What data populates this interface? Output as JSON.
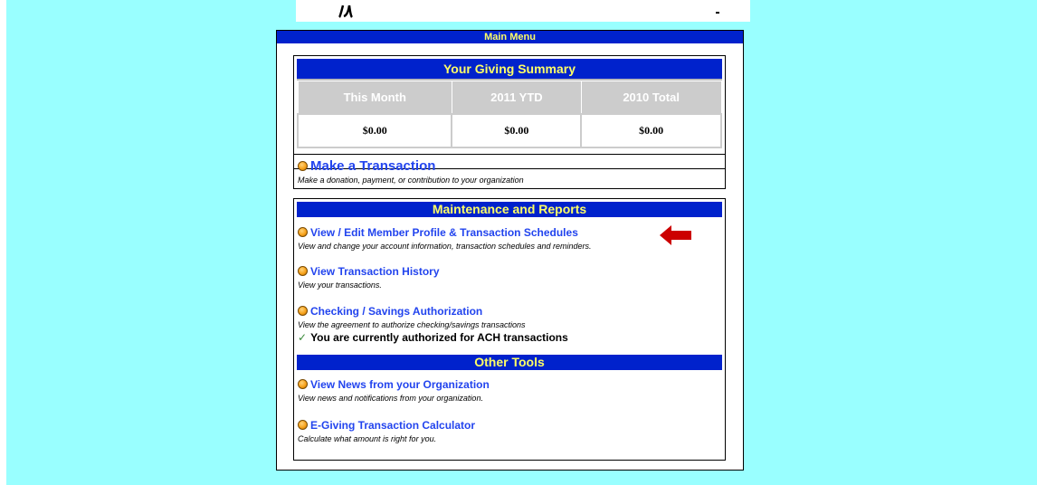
{
  "main_menu": {
    "title": "Main Menu"
  },
  "giving_summary": {
    "title": "Your Giving Summary",
    "columns": [
      "This Month",
      "2011 YTD",
      "2010 Total"
    ],
    "values": [
      "$0.00",
      "$0.00",
      "$0.00"
    ]
  },
  "make_transaction": {
    "label": "Make a Transaction",
    "description": "Make a donation, payment, or contribution to your organization"
  },
  "maintenance": {
    "title": "Maintenance and Reports",
    "items": [
      {
        "label": "View / Edit Member Profile & Transaction Schedules",
        "description": "View and change your account information, transaction schedules and reminders."
      },
      {
        "label": "View Transaction History",
        "description": "View your transactions."
      },
      {
        "label": "Checking / Savings Authorization",
        "description": "View the agreement to authorize checking/savings transactions"
      }
    ],
    "authorization_status": "You are currently authorized for ACH transactions"
  },
  "other_tools": {
    "title": "Other Tools",
    "items": [
      {
        "label": "View News from your Organization",
        "description": "View news and notifications from your organization."
      },
      {
        "label": "E-Giving Transaction Calculator",
        "description": "Calculate what amount is right for you."
      }
    ]
  },
  "colors": {
    "background": "#99ffff",
    "header_blue": "#0022cc",
    "header_text": "#ffff66",
    "link": "#2244ee",
    "arrow": "#cc0000"
  }
}
